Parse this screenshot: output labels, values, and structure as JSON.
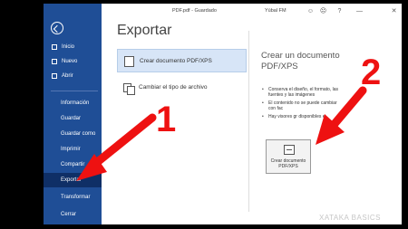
{
  "titlebar": {
    "doc": "PDF.pdf - Guardado",
    "user": "Yúbal FM",
    "smiley": "☺",
    "frown": "☹",
    "help": "?",
    "minimize": "—",
    "close": "✕"
  },
  "sidebar": {
    "items": [
      {
        "label": "Inicio"
      },
      {
        "label": "Nuevo"
      },
      {
        "label": "Abrir"
      },
      {
        "label": "Información"
      },
      {
        "label": "Guardar"
      },
      {
        "label": "Guardar como"
      },
      {
        "label": "Imprimir"
      },
      {
        "label": "Compartir"
      },
      {
        "label": "Exportar"
      },
      {
        "label": "Transformar"
      },
      {
        "label": "Cerrar"
      }
    ]
  },
  "main": {
    "title": "Exportar",
    "options": [
      {
        "label": "Crear documento PDF/XPS"
      },
      {
        "label": "Cambiar el tipo de archivo"
      }
    ]
  },
  "right_pane": {
    "title": "Crear un documento PDF/XPS",
    "bullets": [
      "Conserva el diseño, el formato, las fuentes y las imágenes",
      "El contenido no se puede cambiar con fac",
      "Hay visores gr disponibles e"
    ],
    "button_label": "Crear documento PDF/XPS"
  },
  "annotations": {
    "step1": "1",
    "step2": "2",
    "arrow_color": "#ee1111"
  },
  "watermark": "XATAKA BASICS"
}
